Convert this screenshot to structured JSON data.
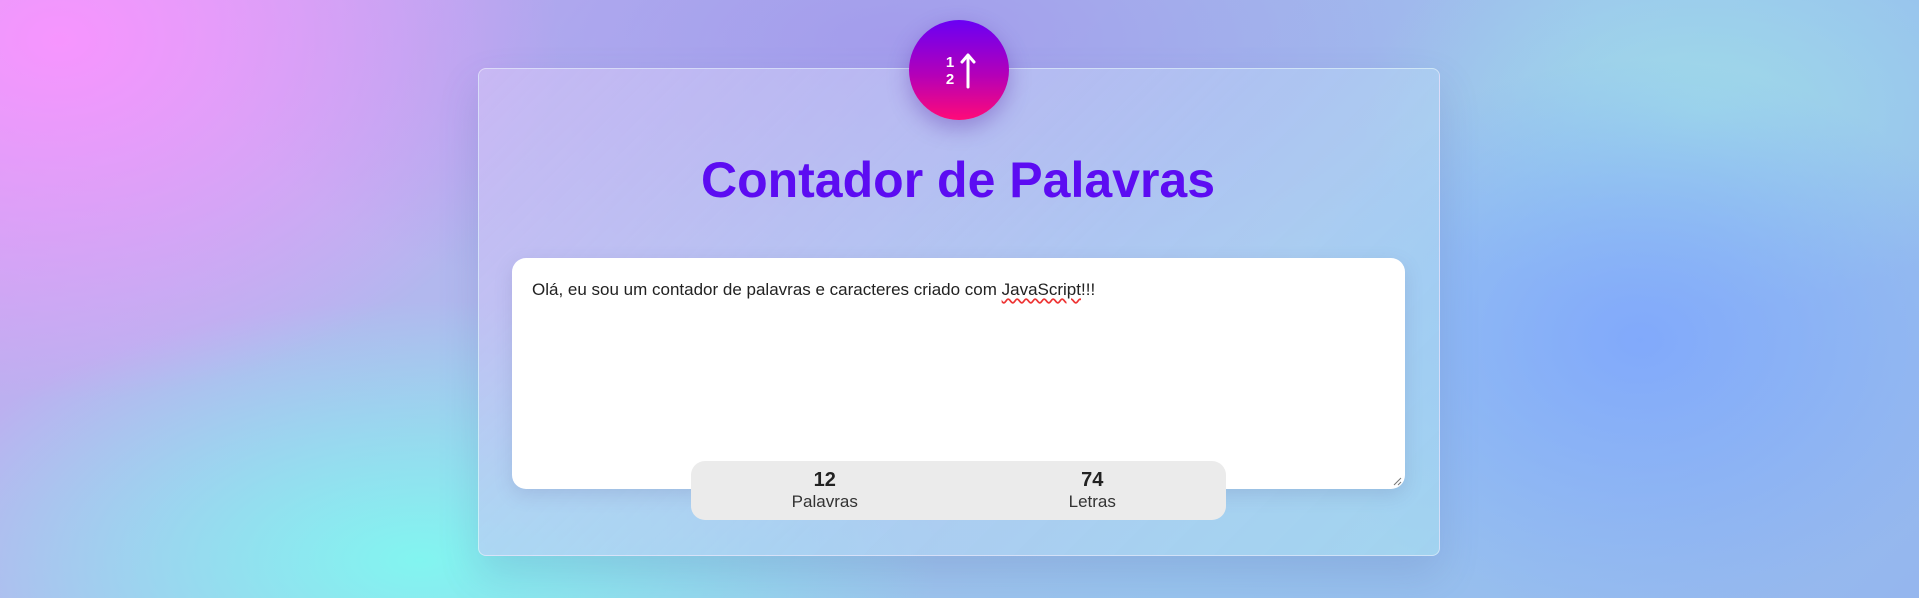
{
  "header": {
    "logo_icon": "sort-numeric-up-icon",
    "title": "Contador de Palavras"
  },
  "editor": {
    "text_before": "Olá, eu sou um contador de palavras e caracteres criado com ",
    "text_flagged": "JavaScript",
    "text_after": "!!!"
  },
  "stats": {
    "words": {
      "value": "12",
      "label": "Palavras"
    },
    "letters": {
      "value": "74",
      "label": "Letras"
    }
  },
  "colors": {
    "title": "#5c0cf2",
    "logo_top": "#6a00f4",
    "logo_bottom": "#ff0a78"
  }
}
